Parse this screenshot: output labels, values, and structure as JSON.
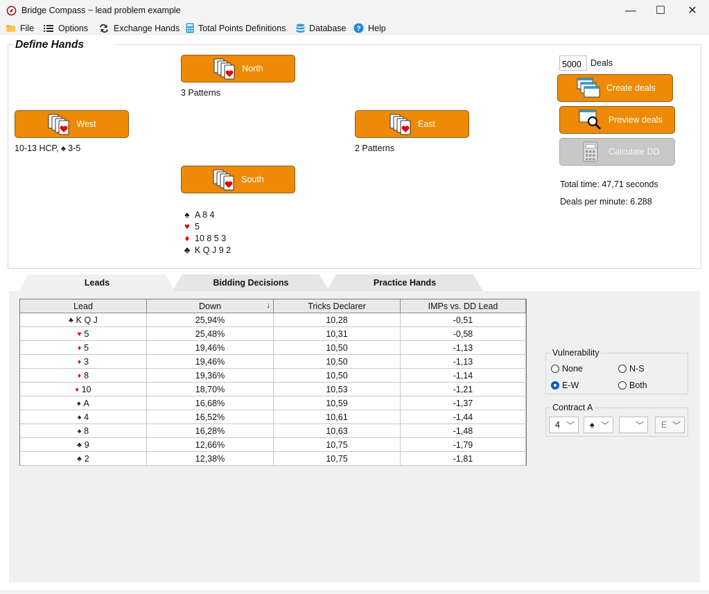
{
  "window": {
    "title": "Bridge Compass  ~  lead problem example",
    "minimize": "—",
    "maximize": "☐",
    "close": "✕"
  },
  "menu": {
    "file": "File",
    "options": "Options",
    "exchange": "Exchange Hands",
    "total_points": "Total Points Definitions",
    "database": "Database",
    "help": "Help"
  },
  "define": {
    "title": "Define Hands",
    "north": {
      "label": "North",
      "note": "3 Patterns"
    },
    "west": {
      "label": "West",
      "note": "10-13 HCP, ♠ 3-5"
    },
    "east": {
      "label": "East",
      "note": "2 Patterns"
    },
    "south": {
      "label": "South",
      "spades": "A 8 4",
      "hearts": "5",
      "diamonds": "10 8 5 3",
      "clubs": "K Q J 9 2"
    }
  },
  "deals": {
    "count": "5000",
    "label": "Deals",
    "create": "Create deals",
    "preview": "Preview deals",
    "calculate": "Calculate DD",
    "total_time": "Total time: 47,71 seconds",
    "per_minute": "Deals per minute: 6.288"
  },
  "tabs": {
    "leads": "Leads",
    "bidding": "Bidding Decisions",
    "practice": "Practice Hands"
  },
  "table": {
    "headers": [
      "Lead",
      "Down",
      "Tricks Declarer",
      "IMPs vs. DD Lead"
    ],
    "sort_indicator": "↓",
    "rows": [
      {
        "suit": "♣",
        "color": "blk",
        "card": "K Q J",
        "down": "25,94%",
        "tricks": "10,28",
        "imps": "-0,51"
      },
      {
        "suit": "♥",
        "color": "red",
        "card": "5",
        "down": "25,48%",
        "tricks": "10,31",
        "imps": "-0,58"
      },
      {
        "suit": "♦",
        "color": "red",
        "card": "5",
        "down": "19,46%",
        "tricks": "10,50",
        "imps": "-1,13"
      },
      {
        "suit": "♦",
        "color": "red",
        "card": "3",
        "down": "19,46%",
        "tricks": "10,50",
        "imps": "-1,13"
      },
      {
        "suit": "♦",
        "color": "red",
        "card": "8",
        "down": "19,36%",
        "tricks": "10,50",
        "imps": "-1,14"
      },
      {
        "suit": "♦",
        "color": "red",
        "card": "10",
        "down": "18,70%",
        "tricks": "10,53",
        "imps": "-1,21"
      },
      {
        "suit": "♠",
        "color": "blk",
        "card": "A",
        "down": "16,68%",
        "tricks": "10,59",
        "imps": "-1,37"
      },
      {
        "suit": "♠",
        "color": "blk",
        "card": "4",
        "down": "16,52%",
        "tricks": "10,61",
        "imps": "-1,44"
      },
      {
        "suit": "♠",
        "color": "blk",
        "card": "8",
        "down": "16,28%",
        "tricks": "10,63",
        "imps": "-1,48"
      },
      {
        "suit": "♣",
        "color": "blk",
        "card": "9",
        "down": "12,66%",
        "tricks": "10,75",
        "imps": "-1,79"
      },
      {
        "suit": "♣",
        "color": "blk",
        "card": "2",
        "down": "12,38%",
        "tricks": "10,75",
        "imps": "-1,81"
      }
    ]
  },
  "vulnerability": {
    "title": "Vulnerability",
    "options": [
      "None",
      "N-S",
      "E-W",
      "Both"
    ],
    "selected": "E-W"
  },
  "contract": {
    "title": "Contract A",
    "level": "4",
    "strain": "♠",
    "double": "",
    "declarer": "E"
  },
  "colors": {
    "accent_orange": "#ee8a06",
    "disabled_gray": "#c8c8c8",
    "heart_red": "#e00000"
  }
}
